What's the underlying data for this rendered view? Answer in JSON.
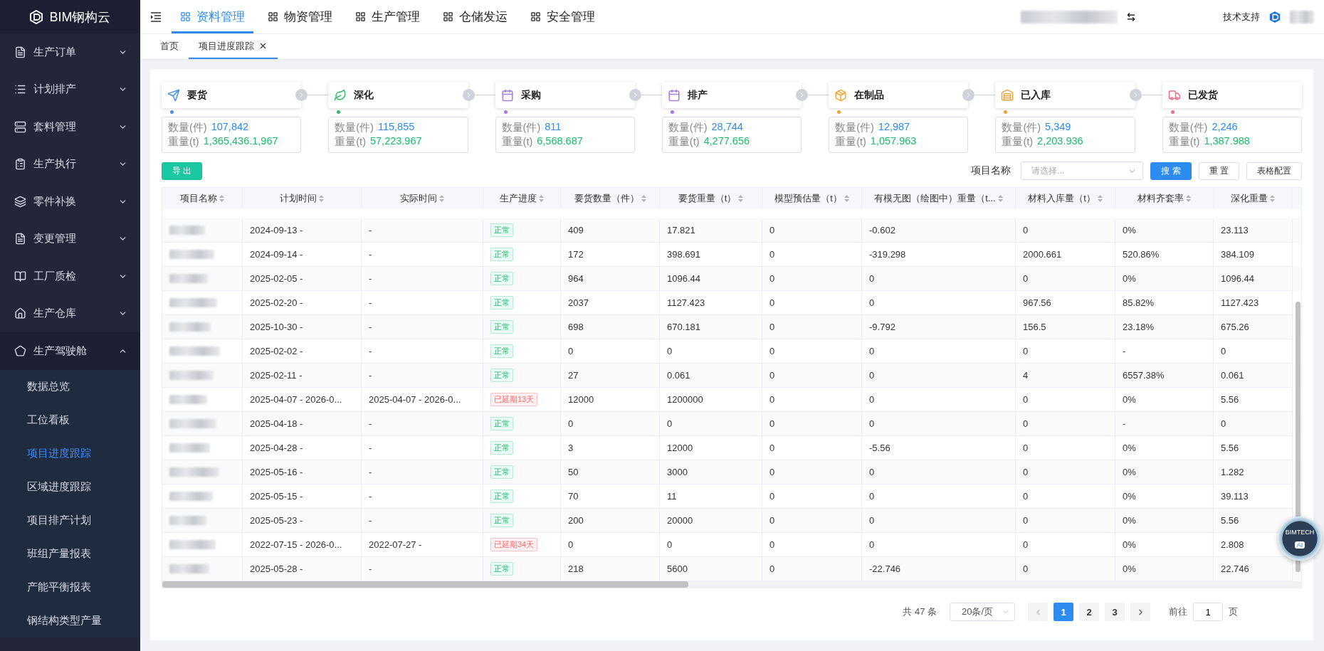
{
  "sidebar": {
    "brand": "BIM钢构云",
    "items": [
      {
        "label": "生产订单",
        "expanded": false
      },
      {
        "label": "计划排产",
        "expanded": false
      },
      {
        "label": "套料管理",
        "expanded": false
      },
      {
        "label": "生产执行",
        "expanded": false
      },
      {
        "label": "零件补换",
        "expanded": false
      },
      {
        "label": "变更管理",
        "expanded": false
      },
      {
        "label": "工厂质检",
        "expanded": false
      },
      {
        "label": "生产仓库",
        "expanded": false
      },
      {
        "label": "生产驾驶舱",
        "expanded": true,
        "children": [
          {
            "label": "数据总览",
            "selected": false
          },
          {
            "label": "工位看板",
            "selected": false
          },
          {
            "label": "项目进度跟踪",
            "selected": true
          },
          {
            "label": "区域进度跟踪",
            "selected": false
          },
          {
            "label": "项目排产计划",
            "selected": false
          },
          {
            "label": "班组产量报表",
            "selected": false
          },
          {
            "label": "产能平衡报表",
            "selected": false
          },
          {
            "label": "钢结构类型产量",
            "selected": false
          }
        ]
      }
    ]
  },
  "top_nav": {
    "tabs": [
      {
        "label": "资料管理",
        "selected": true
      },
      {
        "label": "物资管理",
        "selected": false
      },
      {
        "label": "生产管理",
        "selected": false
      },
      {
        "label": "仓储发运",
        "selected": false
      },
      {
        "label": "安全管理",
        "selected": false
      }
    ],
    "support": "技术支持"
  },
  "page_tabs": [
    {
      "label": "首页",
      "selected": false,
      "closable": false
    },
    {
      "label": "项目进度跟踪",
      "selected": true,
      "closable": true
    }
  ],
  "stages": [
    {
      "title": "要货",
      "color": "#4a90e2",
      "qty_label": "数量(件)",
      "qty": "107,842",
      "weight_label": "重量(t)",
      "weight": "1,365,436.1,967"
    },
    {
      "title": "深化",
      "color": "#2bbf6a",
      "qty_label": "数量(件)",
      "qty": "115,855",
      "weight_label": "重量(t)",
      "weight": "57,223.967"
    },
    {
      "title": "采购",
      "color": "#a77be0",
      "qty_label": "数量(件)",
      "qty": "811",
      "weight_label": "重量(t)",
      "weight": "6,568.687"
    },
    {
      "title": "排产",
      "color": "#a77be0",
      "qty_label": "数量(件)",
      "qty": "28,744",
      "weight_label": "重量(t)",
      "weight": "4,277.656"
    },
    {
      "title": "在制品",
      "color": "#f0a63a",
      "qty_label": "数量(件)",
      "qty": "12,987",
      "weight_label": "重量(t)",
      "weight": "1,057.963"
    },
    {
      "title": "已入库",
      "color": "#e8a53c",
      "qty_label": "数量(件)",
      "qty": "5,349",
      "weight_label": "重量(t)",
      "weight": "2,203.936"
    },
    {
      "title": "已发货",
      "color": "#f06b8a",
      "qty_label": "数量(件)",
      "qty": "2,246",
      "weight_label": "重量(t)",
      "weight": "1,387.988"
    }
  ],
  "toolbar": {
    "export": "导 出",
    "filter_label": "项目名称",
    "filter_placeholder": "请选择...",
    "search": "搜 索",
    "reset": "重 置",
    "config": "表格配置"
  },
  "table": {
    "columns": [
      "项目名称",
      "计划时间",
      "实际时间",
      "生产进度",
      "要货数量（件）",
      "要货重量（t）",
      "模型预估量（t）",
      "有模无图（绘图中）重量（t...",
      "材料入库量（t）",
      "材料齐套率",
      "深化重量"
    ],
    "rows": [
      {
        "plan": "2024-09-13 -",
        "actual": "-",
        "status": {
          "kind": "normal",
          "label": "正常"
        },
        "values": [
          "409",
          "17.821",
          "0",
          "-0.602",
          "0",
          "0%",
          "23.113"
        ]
      },
      {
        "plan": "2024-09-14 -",
        "actual": "-",
        "status": {
          "kind": "normal",
          "label": "正常"
        },
        "values": [
          "172",
          "398.691",
          "0",
          "-319.298",
          "2000.661",
          "520.86%",
          "384.109"
        ]
      },
      {
        "plan": "2025-02-05 -",
        "actual": "-",
        "status": {
          "kind": "normal",
          "label": "正常"
        },
        "values": [
          "964",
          "1096.44",
          "0",
          "0",
          "0",
          "0%",
          "1096.44"
        ]
      },
      {
        "plan": "2025-02-20 -",
        "actual": "-",
        "status": {
          "kind": "normal",
          "label": "正常"
        },
        "values": [
          "2037",
          "1127.423",
          "0",
          "0",
          "967.56",
          "85.82%",
          "1127.423"
        ]
      },
      {
        "plan": "2025-10-30 -",
        "actual": "-",
        "status": {
          "kind": "normal",
          "label": "正常"
        },
        "values": [
          "698",
          "670.181",
          "0",
          "-9.792",
          "156.5",
          "23.18%",
          "675.26"
        ]
      },
      {
        "plan": "2025-02-02 -",
        "actual": "-",
        "status": {
          "kind": "normal",
          "label": "正常"
        },
        "values": [
          "0",
          "0",
          "0",
          "0",
          "0",
          "-",
          "0"
        ]
      },
      {
        "plan": "2025-02-11 -",
        "actual": "-",
        "status": {
          "kind": "normal",
          "label": "正常"
        },
        "values": [
          "27",
          "0.061",
          "0",
          "0",
          "4",
          "6557.38%",
          "0.061"
        ]
      },
      {
        "plan": "2025-04-07 - 2026-0...",
        "actual": "2025-04-07 - 2026-0...",
        "status": {
          "kind": "delayed",
          "label": "已延期13天"
        },
        "values": [
          "12000",
          "1200000",
          "0",
          "0",
          "0",
          "0%",
          "5.56"
        ]
      },
      {
        "plan": "2025-04-18 -",
        "actual": "-",
        "status": {
          "kind": "normal",
          "label": "正常"
        },
        "values": [
          "0",
          "0",
          "0",
          "0",
          "0",
          "-",
          "0"
        ]
      },
      {
        "plan": "2025-04-28 -",
        "actual": "-",
        "status": {
          "kind": "normal",
          "label": "正常"
        },
        "values": [
          "3",
          "12000",
          "0",
          "-5.56",
          "0",
          "0%",
          "5.56"
        ]
      },
      {
        "plan": "2025-05-16 -",
        "actual": "-",
        "status": {
          "kind": "normal",
          "label": "正常"
        },
        "values": [
          "50",
          "3000",
          "0",
          "0",
          "0",
          "0%",
          "1.282"
        ]
      },
      {
        "plan": "2025-05-15 -",
        "actual": "-",
        "status": {
          "kind": "normal",
          "label": "正常"
        },
        "values": [
          "70",
          "11",
          "0",
          "0",
          "0",
          "0%",
          "39.113"
        ]
      },
      {
        "plan": "2025-05-23 -",
        "actual": "-",
        "status": {
          "kind": "normal",
          "label": "正常"
        },
        "values": [
          "200",
          "20000",
          "0",
          "0",
          "0",
          "0%",
          "5.56"
        ]
      },
      {
        "plan": "2022-07-15 - 2026-0...",
        "actual": "2022-07-27 -",
        "status": {
          "kind": "delayed",
          "label": "已延期34天"
        },
        "values": [
          "0",
          "0",
          "0",
          "0",
          "0",
          "0%",
          "2.808"
        ]
      },
      {
        "plan": "2025-05-28 -",
        "actual": "-",
        "status": {
          "kind": "normal",
          "label": "正常"
        },
        "values": [
          "218",
          "5600",
          "0",
          "-22.746",
          "0",
          "0%",
          "22.746"
        ]
      }
    ]
  },
  "pagination": {
    "total": "共 47 条",
    "page_size": "20条/页",
    "pages": [
      {
        "label": "1",
        "selected": true
      },
      {
        "label": "2",
        "selected": false
      },
      {
        "label": "3",
        "selected": false
      }
    ],
    "goto_label": "前往",
    "goto_value": "1",
    "goto_suffix": "页"
  },
  "assistant": {
    "label": "BIMTECH",
    "badge": "AI"
  }
}
